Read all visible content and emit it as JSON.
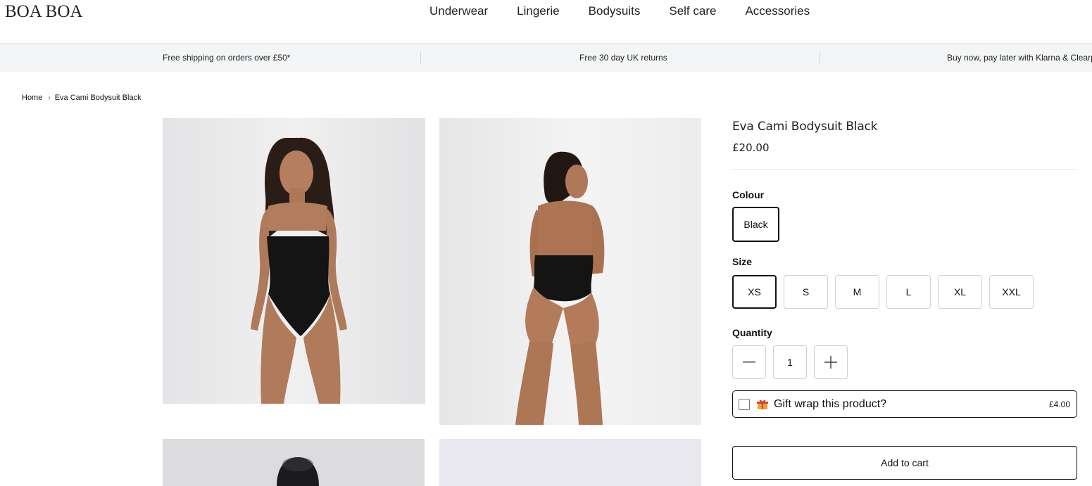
{
  "header": {
    "logo": "BOA BOA",
    "nav": [
      "Underwear",
      "Lingerie",
      "Bodysuits",
      "Self care",
      "Accessories"
    ]
  },
  "announcements": [
    "Free shipping on orders over £50*",
    "Free 30 day UK returns",
    "Buy now, pay later with Klarna & Clearpay"
  ],
  "breadcrumb": {
    "home": "Home",
    "current": "Eva Cami Bodysuit Black"
  },
  "product": {
    "title": "Eva Cami Bodysuit Black",
    "price": "£20.00",
    "colour_label": "Colour",
    "colour_selected": "Black",
    "size_label": "Size",
    "sizes": [
      "XS",
      "S",
      "M",
      "L",
      "XL",
      "XXL"
    ],
    "size_selected": "XS",
    "quantity_label": "Quantity",
    "quantity": "1",
    "gift_wrap_text": "Gift wrap this product?",
    "gift_wrap_price": "£4.00",
    "add_to_cart": "Add to cart"
  },
  "colors": {
    "border_dark": "#111111",
    "announce_bg": "#f4f5f6",
    "photo_bg": "#ededee",
    "swimsuit": "#141414"
  },
  "icons": [
    "chevron-right-icon",
    "minus-icon",
    "plus-icon",
    "gift-icon",
    "checkbox"
  ]
}
